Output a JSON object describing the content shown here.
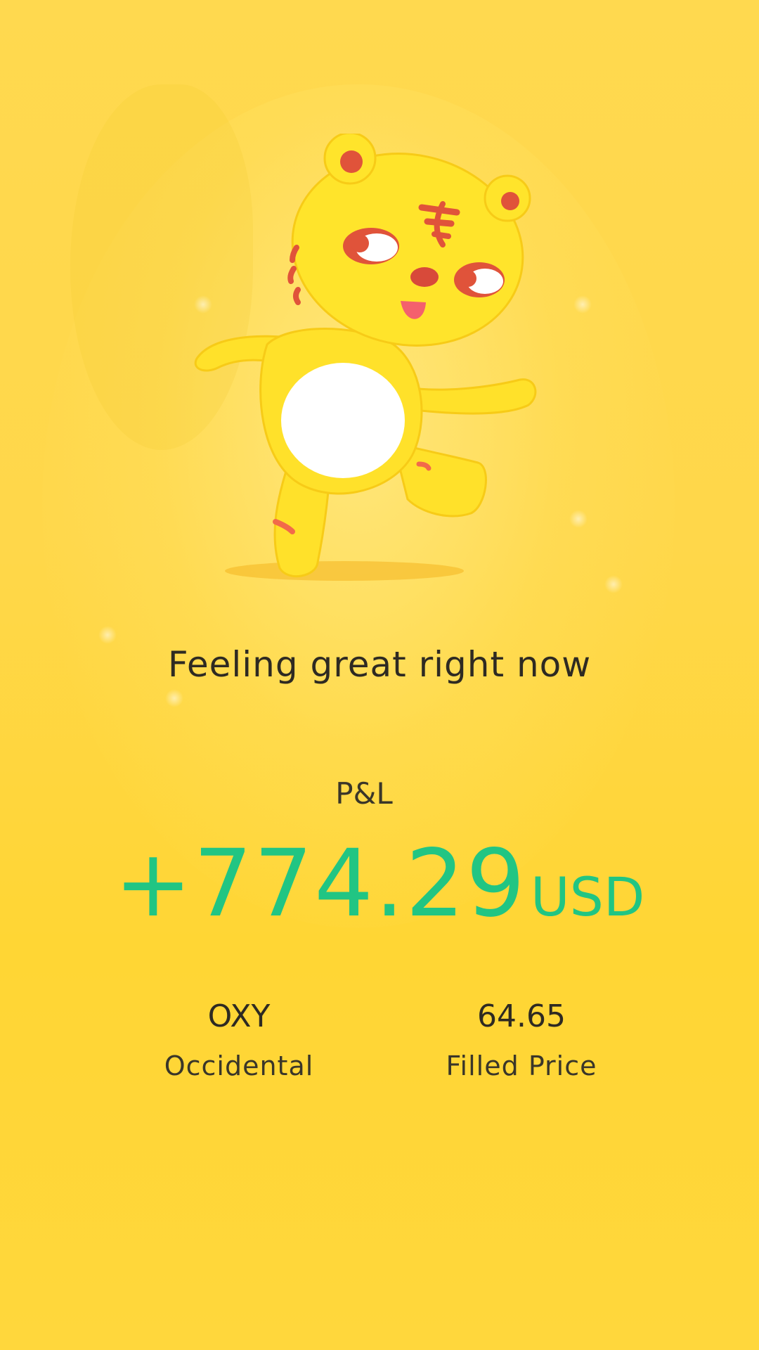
{
  "headline": "Feeling great right now",
  "pnl": {
    "label": "P&L",
    "value": "+774.29",
    "currency": "USD",
    "value_color": "#21C583"
  },
  "stats": {
    "symbol": "OXY",
    "company": "Occidental",
    "filled_price": "64.65",
    "filled_price_label": "Filled Price"
  },
  "colors": {
    "background": "#FFD74A",
    "text": "#2E2A22",
    "profit": "#21C583"
  },
  "mascot": {
    "icon": "tiger-mascot-icon"
  }
}
